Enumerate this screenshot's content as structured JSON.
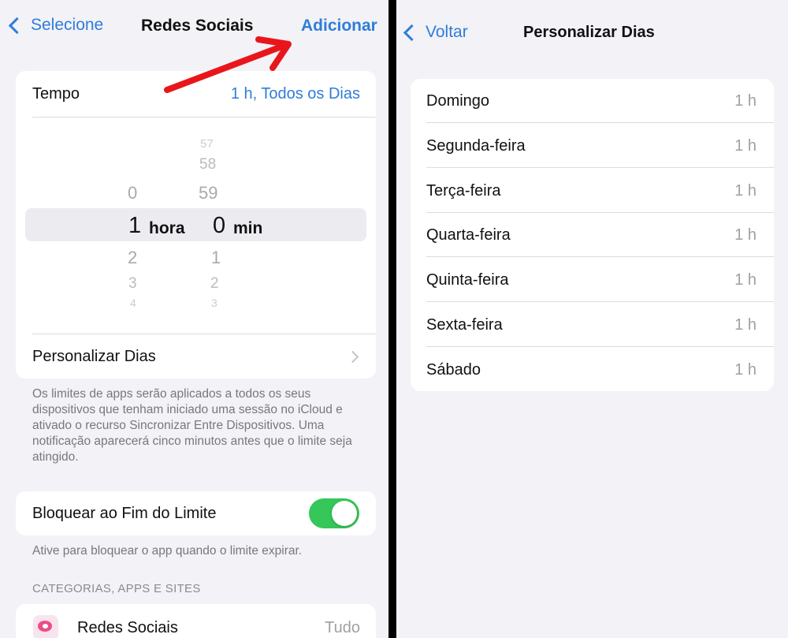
{
  "left": {
    "nav": {
      "back_label": "Selecione",
      "title": "Redes Sociais",
      "action_label": "Adicionar"
    },
    "tempo": {
      "label": "Tempo",
      "value": "1 h, Todos os Dias"
    },
    "picker": {
      "hours": [
        "0",
        "1",
        "2",
        "3",
        "4"
      ],
      "minutes": [
        "57",
        "58",
        "59",
        "0",
        "1",
        "2",
        "3"
      ],
      "hour_unit": "hora",
      "minute_unit": "min"
    },
    "personalizar": {
      "label": "Personalizar Dias"
    },
    "limits_note": "Os limites de apps serão aplicados a todos os seus dispositivos que tenham iniciado uma sessão no iCloud e ativado o recurso Sincronizar Entre Dispositivos. Uma notificação aparecerá cinco minutos antes que o limite seja atingido.",
    "block": {
      "label": "Bloquear ao Fim do Limite",
      "enabled": true
    },
    "block_note": "Ative para bloquear o app quando o limite expirar.",
    "section_header": "CATEGORIAS, APPS E SITES",
    "category": {
      "label": "Redes Sociais",
      "value": "Tudo"
    }
  },
  "right": {
    "nav": {
      "back_label": "Voltar",
      "title": "Personalizar Dias"
    },
    "days": [
      {
        "label": "Domingo",
        "value": "1 h"
      },
      {
        "label": "Segunda-feira",
        "value": "1 h"
      },
      {
        "label": "Terça-feira",
        "value": "1 h"
      },
      {
        "label": "Quarta-feira",
        "value": "1 h"
      },
      {
        "label": "Quinta-feira",
        "value": "1 h"
      },
      {
        "label": "Sexta-feira",
        "value": "1 h"
      },
      {
        "label": "Sábado",
        "value": "1 h"
      }
    ]
  },
  "colors": {
    "accent": "#2f7dd8",
    "toggle_on": "#35c759",
    "annotation_arrow": "#e8161b"
  }
}
